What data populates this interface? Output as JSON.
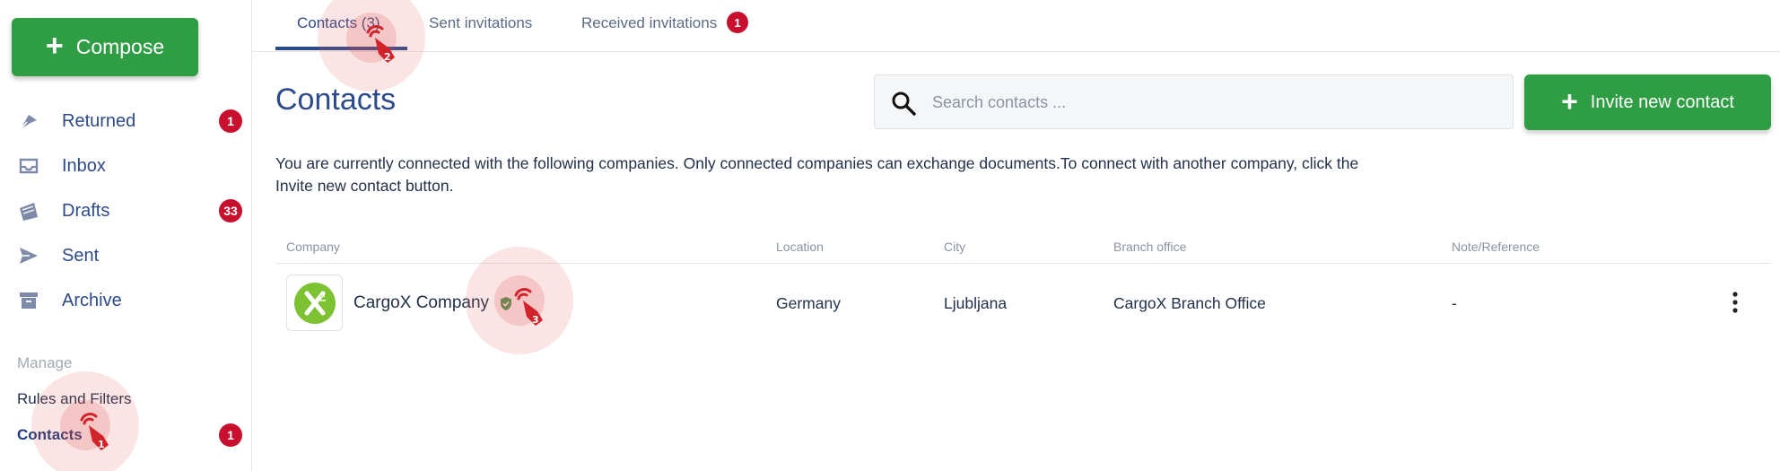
{
  "sidebar": {
    "compose_label": "Compose",
    "nav": [
      {
        "label": "Returned",
        "badge": "1",
        "icon": "returned-icon"
      },
      {
        "label": "Inbox",
        "badge": "",
        "icon": "inbox-icon"
      },
      {
        "label": "Drafts",
        "badge": "33",
        "icon": "drafts-icon"
      },
      {
        "label": "Sent",
        "badge": "",
        "icon": "send-icon"
      },
      {
        "label": "Archive",
        "badge": "",
        "icon": "archive-icon"
      }
    ],
    "manage_label": "Manage",
    "rules_label": "Rules and Filters",
    "contacts_label": "Contacts",
    "contacts_badge": "1"
  },
  "tabs": [
    {
      "label": "Contacts (3)",
      "active": true
    },
    {
      "label": "Sent invitations",
      "active": false
    },
    {
      "label": "Received invitations",
      "badge": "1",
      "active": false
    }
  ],
  "page": {
    "title": "Contacts",
    "search_placeholder": "Search contacts ...",
    "invite_label": "Invite new contact",
    "description": "You are currently connected with the following companies. Only connected companies can exchange documents.To connect with another company, click the Invite new contact button."
  },
  "table": {
    "columns": [
      "Company",
      "Location",
      "City",
      "Branch office",
      "Note/Reference"
    ],
    "rows": [
      {
        "company": "CargoX Company",
        "verified": true,
        "location": "Germany",
        "city": "Ljubljana",
        "branch": "CargoX Branch Office",
        "note": "-"
      }
    ]
  },
  "markers": [
    "1",
    "2",
    "3"
  ],
  "colors": {
    "primary_green": "#2e9d44",
    "nav_blue": "#2d4a8a",
    "badge_red": "#c8102e",
    "cargox_logo_green": "#7cc232"
  }
}
